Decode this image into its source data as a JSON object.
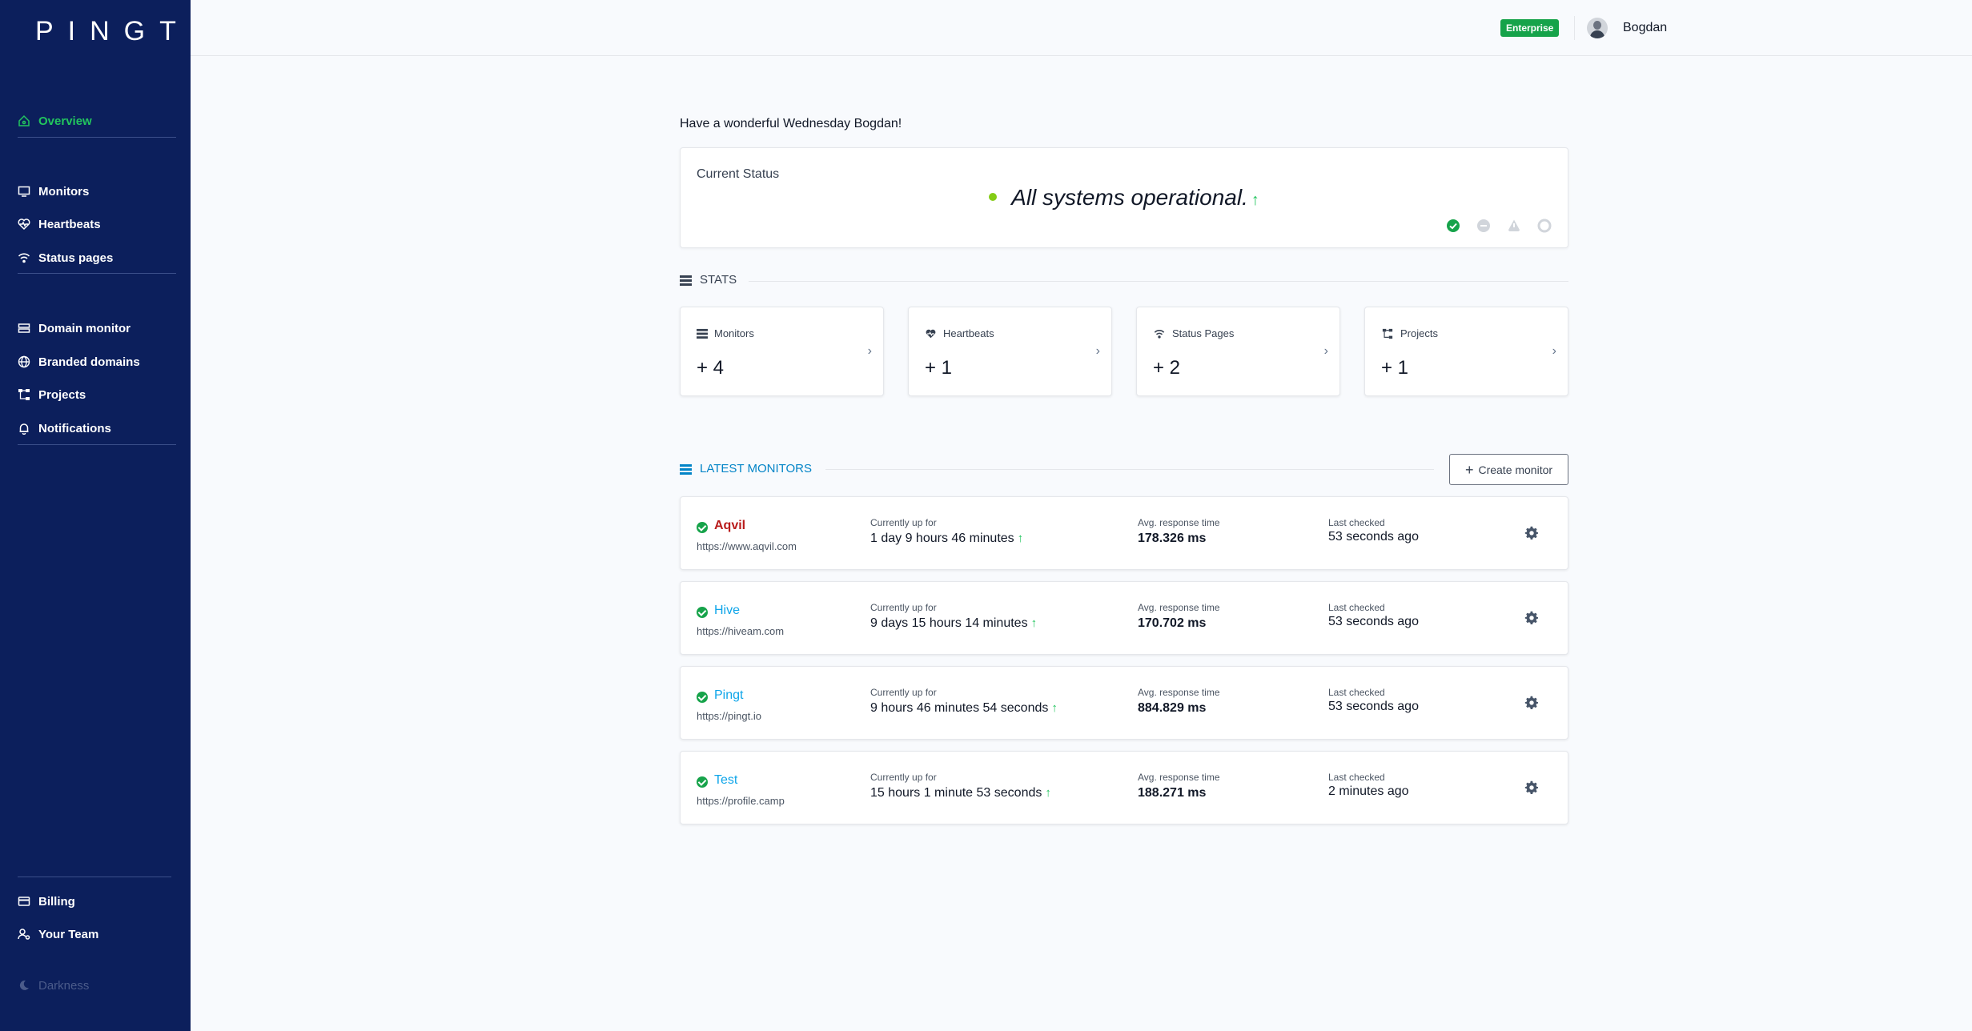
{
  "app": {
    "logo": "PINGT"
  },
  "sidebar": {
    "items": [
      {
        "label": "Overview"
      },
      {
        "label": "Monitors"
      },
      {
        "label": "Heartbeats"
      },
      {
        "label": "Status pages"
      },
      {
        "label": "Domain monitor"
      },
      {
        "label": "Branded domains"
      },
      {
        "label": "Projects"
      },
      {
        "label": "Notifications"
      },
      {
        "label": "Billing"
      },
      {
        "label": "Your Team"
      },
      {
        "label": "Darkness"
      }
    ]
  },
  "header": {
    "plan_badge": "Enterprise",
    "user_name": "Bogdan"
  },
  "greeting": "Have a wonderful Wednesday Bogdan!",
  "status": {
    "title": "Current Status",
    "message": "All systems operational.",
    "arrow": "↑"
  },
  "stats": {
    "heading": "STATS",
    "cards": [
      {
        "label": "Monitors",
        "value": "+ 4"
      },
      {
        "label": "Heartbeats",
        "value": "+ 1"
      },
      {
        "label": "Status Pages",
        "value": "+ 2"
      },
      {
        "label": "Projects",
        "value": "+ 1"
      }
    ]
  },
  "latest": {
    "heading": "LATEST MONITORS",
    "create_label": "Create monitor",
    "up_label": "Currently up for",
    "resp_label": "Avg. response time",
    "checked_label": "Last checked",
    "monitors": [
      {
        "name": "Aqvil",
        "url": "https://www.aqvil.com",
        "uptime": "1 day 9 hours 46 minutes",
        "response": "178.326 ms",
        "checked": "53 seconds ago"
      },
      {
        "name": "Hive",
        "url": "https://hiveam.com",
        "uptime": "9 days 15 hours 14 minutes",
        "response": "170.702 ms",
        "checked": "53 seconds ago"
      },
      {
        "name": "Pingt",
        "url": "https://pingt.io",
        "uptime": "9 hours 46 minutes 54 seconds",
        "response": "884.829 ms",
        "checked": "53 seconds ago"
      },
      {
        "name": "Test",
        "url": "https://profile.camp",
        "uptime": "15 hours 1 minute 53 seconds",
        "response": "188.271 ms",
        "checked": "2 minutes ago"
      }
    ]
  },
  "colors": {
    "sidebar": "#0c1f5c",
    "accent": "#22c55e",
    "link": "#0ea5e9",
    "alert": "#b91c1c"
  }
}
